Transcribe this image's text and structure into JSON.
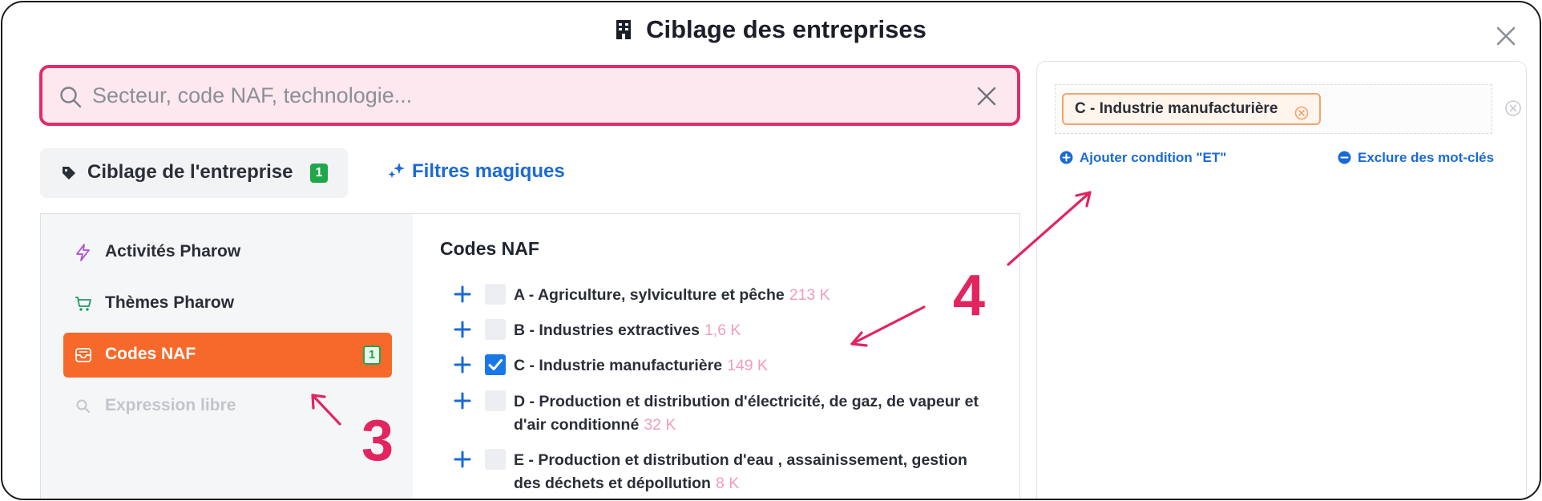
{
  "dialog": {
    "title": "Ciblage des entreprises"
  },
  "search": {
    "placeholder": "Secteur, code NAF, technologie...",
    "value": ""
  },
  "tabs": {
    "company": {
      "label": "Ciblage de l'entreprise",
      "badge": "1"
    },
    "magic": {
      "label": "Filtres magiques"
    }
  },
  "sidebar": {
    "items": [
      {
        "label": "Activités Pharow",
        "icon": "lightning-icon",
        "state": "normal"
      },
      {
        "label": "Thèmes Pharow",
        "icon": "cart-icon",
        "state": "normal"
      },
      {
        "label": "Codes NAF",
        "icon": "inbox-icon",
        "state": "active",
        "badge": "1"
      },
      {
        "label": "Expression libre",
        "icon": "search-icon",
        "state": "disabled"
      }
    ]
  },
  "codes": {
    "title": "Codes NAF",
    "items": [
      {
        "text": "A - Agriculture, sylviculture et pêche",
        "count": "213 K",
        "checked": false
      },
      {
        "text": "B - Industries extractives",
        "count": "1,6 K",
        "checked": false
      },
      {
        "text": "C - Industrie manufacturière",
        "count": "149 K",
        "checked": true
      },
      {
        "text": "D - Production et distribution d'électricité, de gaz, de vapeur et d'air conditionné",
        "count": "32 K",
        "checked": false
      },
      {
        "text": "E - Production et distribution d'eau , assainissement, gestion des déchets et dépollution",
        "count": "8 K",
        "checked": false
      }
    ]
  },
  "selection": {
    "chips": [
      {
        "label": "C - Industrie manufacturière"
      }
    ],
    "add_and_label": "Ajouter condition \"ET\"",
    "exclude_label": "Exclure des mot-clés"
  },
  "annotations": {
    "step3": "3",
    "step4": "4"
  },
  "colors": {
    "accent_pink": "#e2245f",
    "active_orange": "#f7692a",
    "link_blue": "#1a6ad6",
    "badge_green": "#1fa64a",
    "count_pink": "#f29cbf"
  }
}
